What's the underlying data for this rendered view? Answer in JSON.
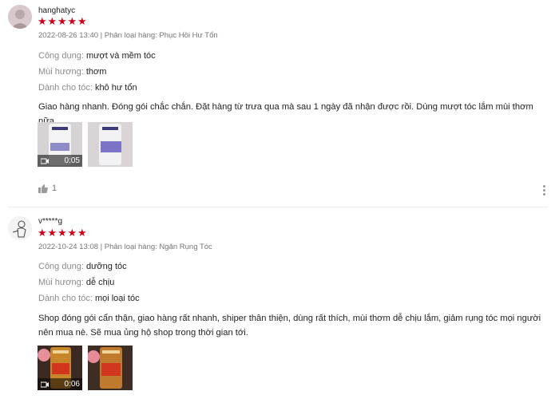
{
  "reviews": [
    {
      "username": "hanghatyc",
      "rating": 5,
      "meta": "2022-08-26 13:40 | Phân loại hàng: Phục Hồi Hư Tổn",
      "attributes": [
        {
          "key": "Công dụng:",
          "value": "mượt và mềm tóc"
        },
        {
          "key": "Mùi hương:",
          "value": "thơm"
        },
        {
          "key": "Dành cho tóc:",
          "value": "khô hư tổn"
        }
      ],
      "content": "Giao hàng nhanh. Đóng gói chắc chắn. Đặt hàng từ trưa qua mà sau 1 ngày đã nhận được rồi. Dùng mượt tóc lắm mùi thơm nữa",
      "media": [
        {
          "type": "video",
          "duration": "0:05",
          "color": "#8f8ac8"
        },
        {
          "type": "image",
          "color": "#7b74c6"
        }
      ],
      "likes": "1"
    },
    {
      "username": "v*****g",
      "rating": 5,
      "meta": "2022-10-24 13:08 | Phân loại hàng: Ngăn Rụng Tóc",
      "attributes": [
        {
          "key": "Công dụng:",
          "value": "dưỡng tóc"
        },
        {
          "key": "Mùi hương:",
          "value": "dễ chịu"
        },
        {
          "key": "Dành cho tóc:",
          "value": "mọi loại tóc"
        }
      ],
      "content": "Shop đóng gói cẩn thận, giao hàng rất nhanh, shiper thân thiện, dùng rất thích, mùi thơm dễ chịu lắm, giảm rụng tóc mọi người nên mua nè. Sẽ mua ủng hộ shop trong thời gian tới.",
      "media": [
        {
          "type": "video",
          "duration": "0:06",
          "color": "#c8862a"
        },
        {
          "type": "image",
          "color": "#c07a2e"
        }
      ]
    }
  ],
  "colors": {
    "star": "#d0011b",
    "muted": "#757575"
  },
  "icons": {
    "like": "thumbs-up-icon",
    "more": "vertical-dots-icon",
    "video": "video-camera-icon"
  }
}
